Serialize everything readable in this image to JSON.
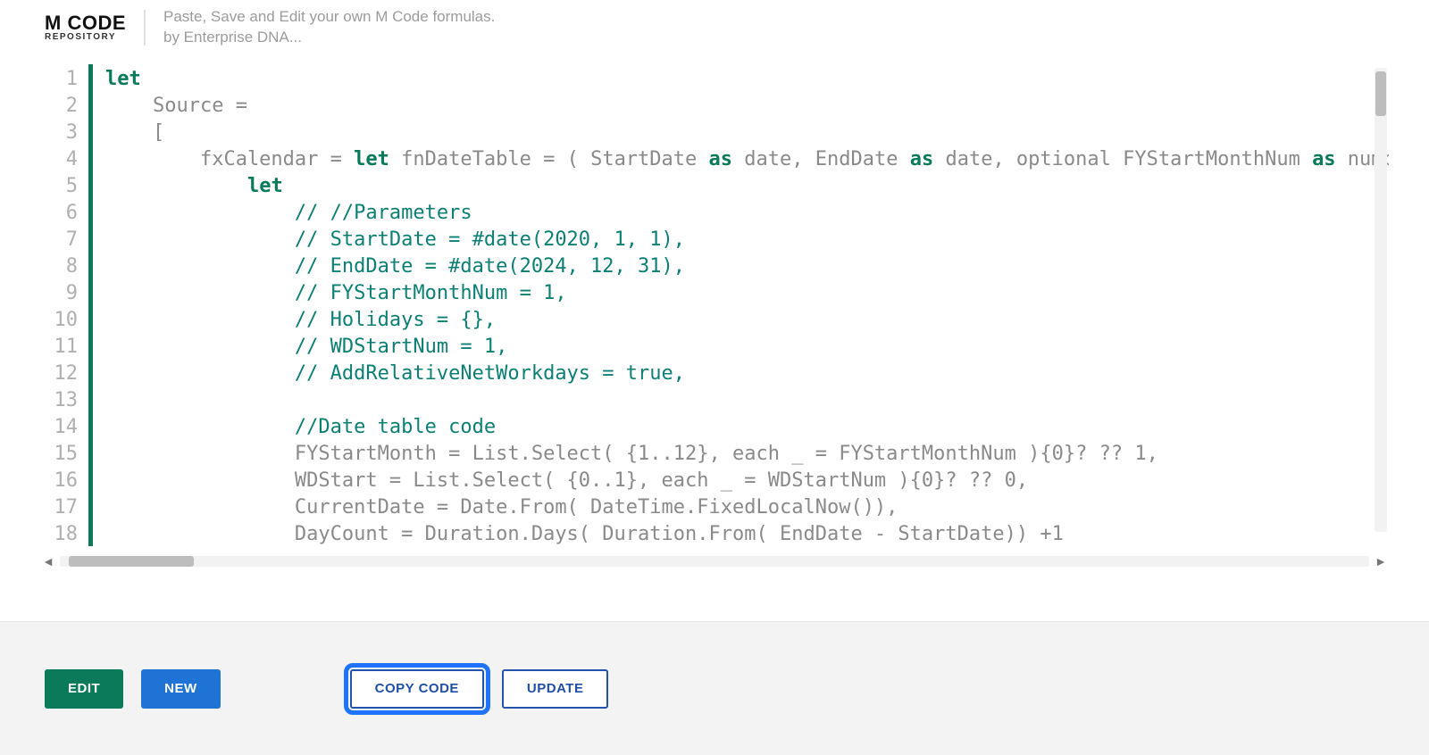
{
  "header": {
    "logo_top": "M CODE",
    "logo_bottom": "REPOSITORY",
    "tagline_line1": "Paste, Save and Edit your own M Code formulas.",
    "tagline_line2": "by Enterprise DNA..."
  },
  "editor": {
    "line_numbers": [
      "1",
      "2",
      "3",
      "4",
      "5",
      "6",
      "7",
      "8",
      "9",
      "10",
      "11",
      "12",
      "13",
      "14",
      "15",
      "16",
      "17",
      "18"
    ],
    "lines": [
      {
        "segments": [
          {
            "t": "let",
            "c": "kw"
          }
        ]
      },
      {
        "segments": [
          {
            "t": "    Source =",
            "c": ""
          }
        ]
      },
      {
        "segments": [
          {
            "t": "    [",
            "c": ""
          }
        ]
      },
      {
        "segments": [
          {
            "t": "        fxCalendar = ",
            "c": ""
          },
          {
            "t": "let",
            "c": "kw"
          },
          {
            "t": " fnDateTable = ( StartDate ",
            "c": ""
          },
          {
            "t": "as",
            "c": "kw"
          },
          {
            "t": " date, EndDate ",
            "c": ""
          },
          {
            "t": "as",
            "c": "kw"
          },
          {
            "t": " date, optional FYStartMonthNum ",
            "c": ""
          },
          {
            "t": "as",
            "c": "kw"
          },
          {
            "t": " numbe",
            "c": ""
          }
        ]
      },
      {
        "segments": [
          {
            "t": "            ",
            "c": ""
          },
          {
            "t": "let",
            "c": "kw"
          }
        ]
      },
      {
        "segments": [
          {
            "t": "                ",
            "c": ""
          },
          {
            "t": "// //Parameters",
            "c": "cm"
          }
        ]
      },
      {
        "segments": [
          {
            "t": "                ",
            "c": ""
          },
          {
            "t": "// StartDate = #date(2020, 1, 1),",
            "c": "cm"
          }
        ]
      },
      {
        "segments": [
          {
            "t": "                ",
            "c": ""
          },
          {
            "t": "// EndDate = #date(2024, 12, 31),",
            "c": "cm"
          }
        ]
      },
      {
        "segments": [
          {
            "t": "                ",
            "c": ""
          },
          {
            "t": "// FYStartMonthNum = 1,",
            "c": "cm"
          }
        ]
      },
      {
        "segments": [
          {
            "t": "                ",
            "c": ""
          },
          {
            "t": "// Holidays = {},",
            "c": "cm"
          }
        ]
      },
      {
        "segments": [
          {
            "t": "                ",
            "c": ""
          },
          {
            "t": "// WDStartNum = 1,",
            "c": "cm"
          }
        ]
      },
      {
        "segments": [
          {
            "t": "                ",
            "c": ""
          },
          {
            "t": "// AddRelativeNetWorkdays = true,",
            "c": "cm"
          }
        ]
      },
      {
        "segments": [
          {
            "t": "",
            "c": ""
          }
        ]
      },
      {
        "segments": [
          {
            "t": "                ",
            "c": ""
          },
          {
            "t": "//Date table code",
            "c": "cm"
          }
        ]
      },
      {
        "segments": [
          {
            "t": "                FYStartMonth = List.Select( {1..12}, each _ = FYStartMonthNum ){0}? ?? 1,",
            "c": ""
          }
        ]
      },
      {
        "segments": [
          {
            "t": "                WDStart = List.Select( {0..1}, each _ = WDStartNum ){0}? ?? 0,",
            "c": ""
          }
        ]
      },
      {
        "segments": [
          {
            "t": "                CurrentDate = Date.From( DateTime.FixedLocalNow()),",
            "c": ""
          }
        ]
      },
      {
        "segments": [
          {
            "t": "                DayCount = Duration.Days( Duration.From( EndDate - StartDate)) +1",
            "c": ""
          }
        ]
      }
    ]
  },
  "buttons": {
    "edit": "EDIT",
    "new": "NEW",
    "copy": "COPY CODE",
    "update": "UPDATE"
  }
}
